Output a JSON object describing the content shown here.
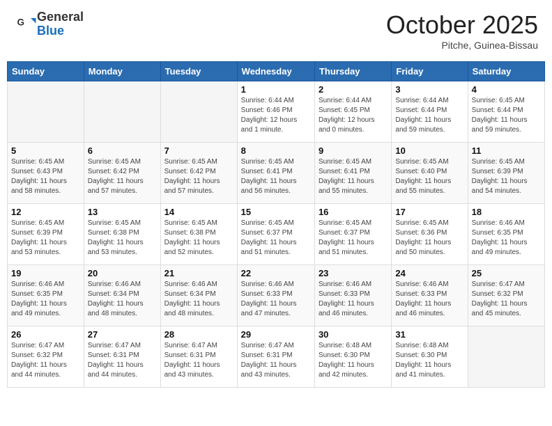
{
  "header": {
    "logo_general": "General",
    "logo_blue": "Blue",
    "month_title": "October 2025",
    "location": "Pitche, Guinea-Bissau"
  },
  "weekdays": [
    "Sunday",
    "Monday",
    "Tuesday",
    "Wednesday",
    "Thursday",
    "Friday",
    "Saturday"
  ],
  "weeks": [
    [
      {
        "day": "",
        "info": ""
      },
      {
        "day": "",
        "info": ""
      },
      {
        "day": "",
        "info": ""
      },
      {
        "day": "1",
        "info": "Sunrise: 6:44 AM\nSunset: 6:46 PM\nDaylight: 12 hours\nand 1 minute."
      },
      {
        "day": "2",
        "info": "Sunrise: 6:44 AM\nSunset: 6:45 PM\nDaylight: 12 hours\nand 0 minutes."
      },
      {
        "day": "3",
        "info": "Sunrise: 6:44 AM\nSunset: 6:44 PM\nDaylight: 11 hours\nand 59 minutes."
      },
      {
        "day": "4",
        "info": "Sunrise: 6:45 AM\nSunset: 6:44 PM\nDaylight: 11 hours\nand 59 minutes."
      }
    ],
    [
      {
        "day": "5",
        "info": "Sunrise: 6:45 AM\nSunset: 6:43 PM\nDaylight: 11 hours\nand 58 minutes."
      },
      {
        "day": "6",
        "info": "Sunrise: 6:45 AM\nSunset: 6:42 PM\nDaylight: 11 hours\nand 57 minutes."
      },
      {
        "day": "7",
        "info": "Sunrise: 6:45 AM\nSunset: 6:42 PM\nDaylight: 11 hours\nand 57 minutes."
      },
      {
        "day": "8",
        "info": "Sunrise: 6:45 AM\nSunset: 6:41 PM\nDaylight: 11 hours\nand 56 minutes."
      },
      {
        "day": "9",
        "info": "Sunrise: 6:45 AM\nSunset: 6:41 PM\nDaylight: 11 hours\nand 55 minutes."
      },
      {
        "day": "10",
        "info": "Sunrise: 6:45 AM\nSunset: 6:40 PM\nDaylight: 11 hours\nand 55 minutes."
      },
      {
        "day": "11",
        "info": "Sunrise: 6:45 AM\nSunset: 6:39 PM\nDaylight: 11 hours\nand 54 minutes."
      }
    ],
    [
      {
        "day": "12",
        "info": "Sunrise: 6:45 AM\nSunset: 6:39 PM\nDaylight: 11 hours\nand 53 minutes."
      },
      {
        "day": "13",
        "info": "Sunrise: 6:45 AM\nSunset: 6:38 PM\nDaylight: 11 hours\nand 53 minutes."
      },
      {
        "day": "14",
        "info": "Sunrise: 6:45 AM\nSunset: 6:38 PM\nDaylight: 11 hours\nand 52 minutes."
      },
      {
        "day": "15",
        "info": "Sunrise: 6:45 AM\nSunset: 6:37 PM\nDaylight: 11 hours\nand 51 minutes."
      },
      {
        "day": "16",
        "info": "Sunrise: 6:45 AM\nSunset: 6:37 PM\nDaylight: 11 hours\nand 51 minutes."
      },
      {
        "day": "17",
        "info": "Sunrise: 6:45 AM\nSunset: 6:36 PM\nDaylight: 11 hours\nand 50 minutes."
      },
      {
        "day": "18",
        "info": "Sunrise: 6:46 AM\nSunset: 6:35 PM\nDaylight: 11 hours\nand 49 minutes."
      }
    ],
    [
      {
        "day": "19",
        "info": "Sunrise: 6:46 AM\nSunset: 6:35 PM\nDaylight: 11 hours\nand 49 minutes."
      },
      {
        "day": "20",
        "info": "Sunrise: 6:46 AM\nSunset: 6:34 PM\nDaylight: 11 hours\nand 48 minutes."
      },
      {
        "day": "21",
        "info": "Sunrise: 6:46 AM\nSunset: 6:34 PM\nDaylight: 11 hours\nand 48 minutes."
      },
      {
        "day": "22",
        "info": "Sunrise: 6:46 AM\nSunset: 6:33 PM\nDaylight: 11 hours\nand 47 minutes."
      },
      {
        "day": "23",
        "info": "Sunrise: 6:46 AM\nSunset: 6:33 PM\nDaylight: 11 hours\nand 46 minutes."
      },
      {
        "day": "24",
        "info": "Sunrise: 6:46 AM\nSunset: 6:33 PM\nDaylight: 11 hours\nand 46 minutes."
      },
      {
        "day": "25",
        "info": "Sunrise: 6:47 AM\nSunset: 6:32 PM\nDaylight: 11 hours\nand 45 minutes."
      }
    ],
    [
      {
        "day": "26",
        "info": "Sunrise: 6:47 AM\nSunset: 6:32 PM\nDaylight: 11 hours\nand 44 minutes."
      },
      {
        "day": "27",
        "info": "Sunrise: 6:47 AM\nSunset: 6:31 PM\nDaylight: 11 hours\nand 44 minutes."
      },
      {
        "day": "28",
        "info": "Sunrise: 6:47 AM\nSunset: 6:31 PM\nDaylight: 11 hours\nand 43 minutes."
      },
      {
        "day": "29",
        "info": "Sunrise: 6:47 AM\nSunset: 6:31 PM\nDaylight: 11 hours\nand 43 minutes."
      },
      {
        "day": "30",
        "info": "Sunrise: 6:48 AM\nSunset: 6:30 PM\nDaylight: 11 hours\nand 42 minutes."
      },
      {
        "day": "31",
        "info": "Sunrise: 6:48 AM\nSunset: 6:30 PM\nDaylight: 11 hours\nand 41 minutes."
      },
      {
        "day": "",
        "info": ""
      }
    ]
  ]
}
